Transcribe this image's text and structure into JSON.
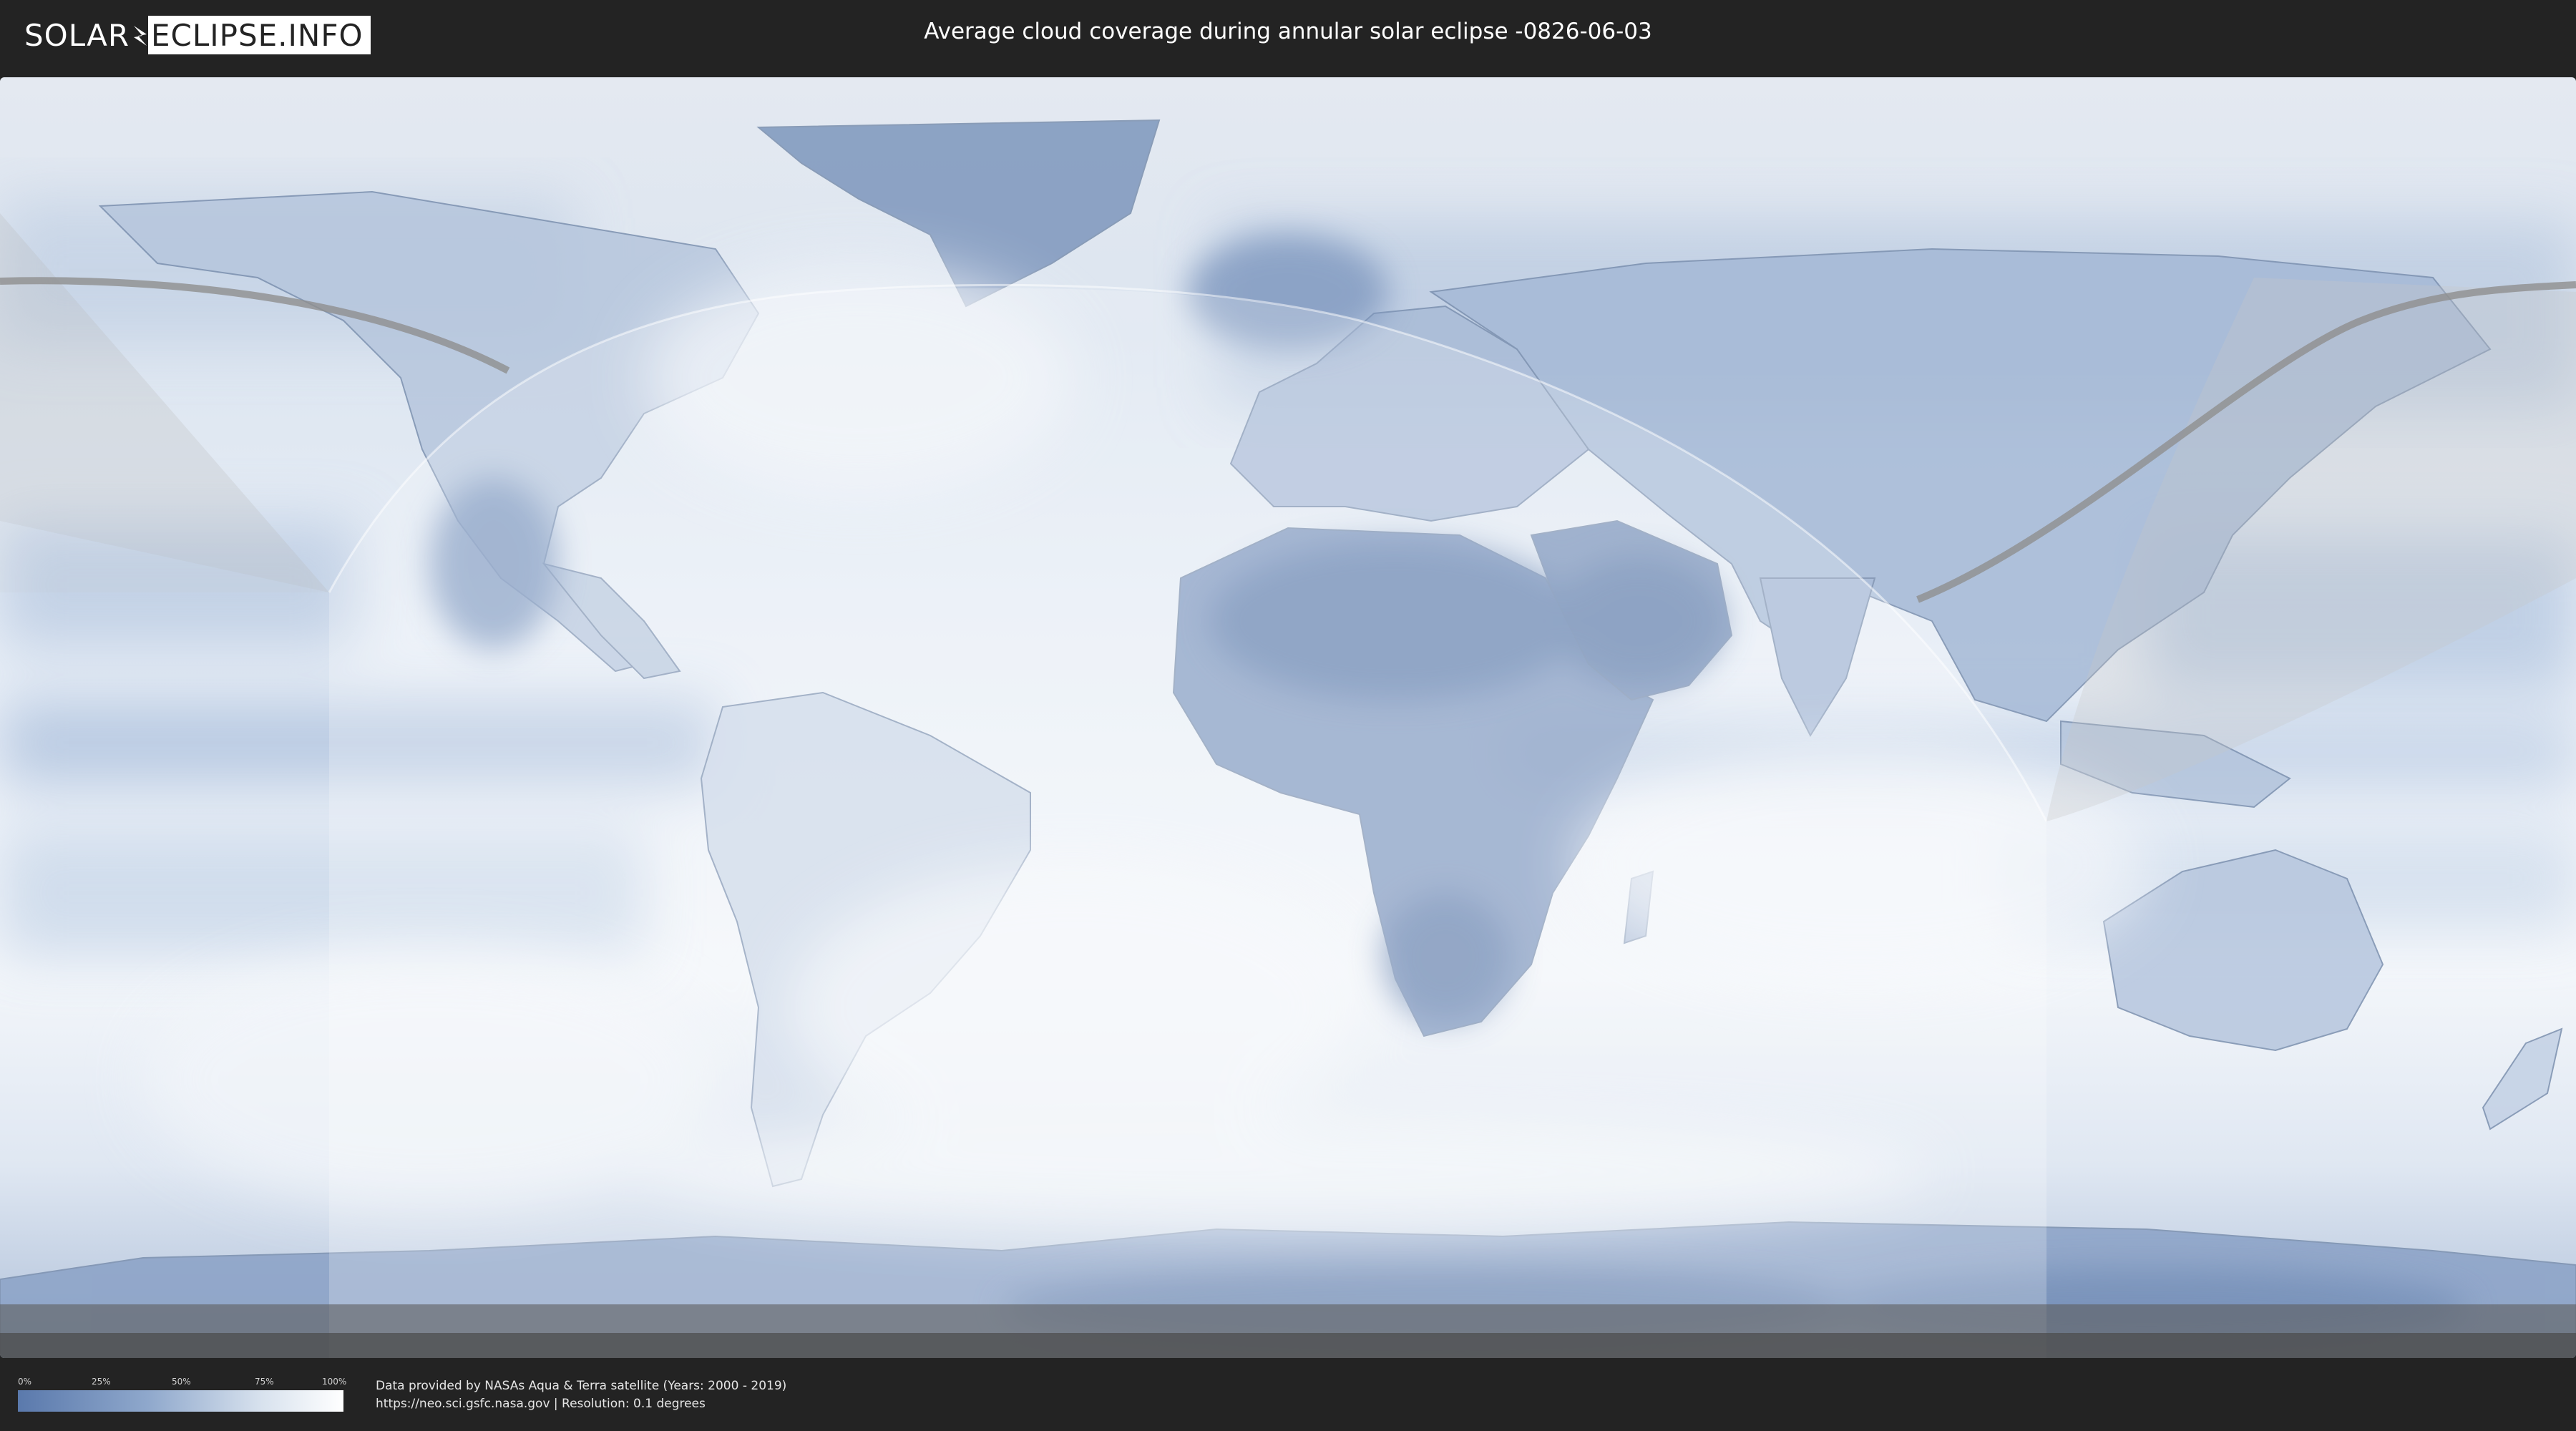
{
  "header": {
    "logo_part1": "SOLAR",
    "logo_part2": "ECLIPSE.INFO",
    "title": "Average cloud coverage during annular solar eclipse -0826-06-03"
  },
  "legend": {
    "ticks": [
      "0%",
      "25%",
      "50%",
      "75%",
      "100%"
    ],
    "colors": {
      "low": "#5a79ac",
      "mid": "#d8e2ee",
      "high": "#ffffff"
    }
  },
  "footer": {
    "credit_line1": "Data provided by NASAs Aqua & Terra satellite (Years: 2000 - 2019)",
    "credit_line2": "https://neo.sci.gsfc.nasa.gov | Resolution: 0.1 degrees"
  },
  "map": {
    "projection": "equirectangular",
    "layers": [
      "cloud-coverage",
      "country-borders",
      "eclipse-visibility-zone",
      "annular-path"
    ]
  }
}
